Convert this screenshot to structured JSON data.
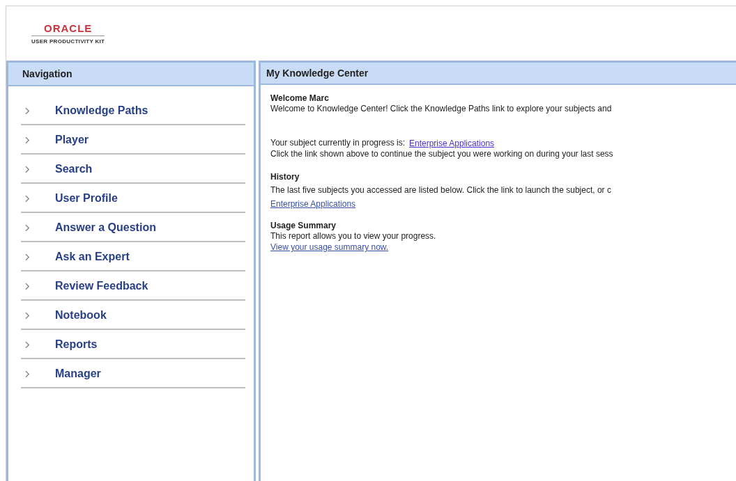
{
  "header": {
    "logo": "ORACLE",
    "product": "USER PRODUCTIVITY KIT"
  },
  "navigation": {
    "title": "Navigation",
    "items": [
      {
        "label": "Knowledge Paths"
      },
      {
        "label": "Player"
      },
      {
        "label": "Search"
      },
      {
        "label": "User Profile"
      },
      {
        "label": "Answer a Question"
      },
      {
        "label": "Ask an Expert"
      },
      {
        "label": "Review Feedback"
      },
      {
        "label": "Notebook"
      },
      {
        "label": "Reports"
      },
      {
        "label": "Manager"
      }
    ]
  },
  "main": {
    "title": "My Knowledge Center",
    "welcome": {
      "heading": "Welcome Marc",
      "text": "Welcome to Knowledge Center! Click the Knowledge Paths link to explore your subjects and"
    },
    "progress": {
      "label": "Your subject currently in progress is:",
      "link": "Enterprise Applications",
      "text": "Click the link shown above to continue the subject you were working on during your last sess"
    },
    "history": {
      "heading": "History",
      "text": "The last five subjects you accessed are listed below. Click the link to launch the subject, or c",
      "links": [
        "Enterprise Applications"
      ]
    },
    "usage": {
      "heading": "Usage Summary",
      "text": "This report allows you to view your progress.",
      "link": "View your usage summary now."
    }
  }
}
